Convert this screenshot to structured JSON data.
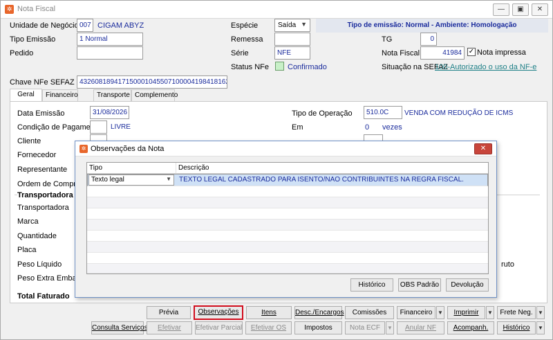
{
  "window": {
    "title": "Nota Fiscal"
  },
  "header": {
    "unidade_label": "Unidade de Negócio",
    "unidade_code": "007",
    "unidade_name": "CIGAM ABYZ",
    "especie_label": "Espécie",
    "especie_value": "Saída",
    "tipo_emissao_banner": "Tipo de emissão: Normal - Ambiente: Homologação",
    "tipo_emissao_label": "Tipo Emissão",
    "tipo_emissao_value": "1 Normal",
    "remessa_label": "Remessa",
    "tg_label": "TG",
    "tg_value": "0",
    "pedido_label": "Pedido",
    "serie_label": "Série",
    "serie_value": "NFE",
    "nota_fiscal_label": "Nota Fiscal",
    "nota_fiscal_value": "41984",
    "nota_impressa_label": "Nota impressa",
    "status_nfe_label": "Status NFe",
    "status_nfe_value": "Confirmado",
    "situacao_label": "Situação na SEFAZ",
    "situacao_value": "100-Autorizado o uso da NF-e",
    "chave_label": "Chave NFe SEFAZ",
    "chave_value": "43260818941715000104550710000419841816229730"
  },
  "tabs": [
    "Geral",
    "Financeiro",
    "Transporte",
    "Complemento"
  ],
  "geral": {
    "data_emissao_label": "Data Emissão",
    "data_emissao_value": "31/08/2026",
    "tipo_operacao_label": "Tipo de Operação",
    "tipo_operacao_code": "510.0C",
    "tipo_operacao_desc": "VENDA COM REDUÇÃO DE ICMS",
    "condicao_label": "Condição de Pagamento",
    "condicao_value": "LIVRE",
    "em_label": "Em",
    "em_value": "0",
    "vezes_label": "vezes",
    "cliente_label": "Cliente",
    "fornecedor_label": "Fornecedor",
    "representante_label": "Representante",
    "ordem_label": "Ordem de Compra",
    "transportadora_group": "Transportadora",
    "transportadora_label": "Transportadora",
    "marca_label": "Marca",
    "quantidade_label": "Quantidade",
    "placa_label": "Placa",
    "peso_liquido_label": "Peso Líquido",
    "peso_extra_label": "Peso Extra Embalagem",
    "bruto_label": "ruto",
    "total_faturado_label": "Total Faturado"
  },
  "dialog": {
    "title": "Observações da Nota",
    "col_tipo": "Tipo",
    "col_descricao": "Descrição",
    "row_tipo": "Texto legal",
    "row_descricao": "TEXTO LEGAL CADASTRADO PARA ISENTO/NAO CONTRIBUINTES NA REGRA FISCAL.",
    "btn_historico": "Histórico",
    "btn_obs_padrao": "OBS Padrão",
    "btn_devolucao": "Devolução"
  },
  "toolbar": {
    "previa": "Prévia",
    "observacoes": "Observações",
    "itens": "Itens",
    "desc_encargos": "Desc./Encargos",
    "comissoes": "Comissões",
    "financeiro": "Financeiro",
    "imprimir": "Imprimir",
    "frete_neg": "Frete Neg.",
    "consulta_servicos": "Consulta Serviços",
    "efetivar": "Efetivar",
    "efetivar_parcial": "Efetivar Parcial",
    "efetivar_os": "Efetivar OS",
    "impostos": "Impostos",
    "nota_ecf": "Nota ECF",
    "anular_nf": "Anular NF",
    "acompanh": "Acompanh.",
    "historico": "Histórico"
  },
  "colors": {
    "accent_blue": "#1a2b9c",
    "highlight_red": "#d10d1d",
    "status_green": "#c8f0c8"
  }
}
